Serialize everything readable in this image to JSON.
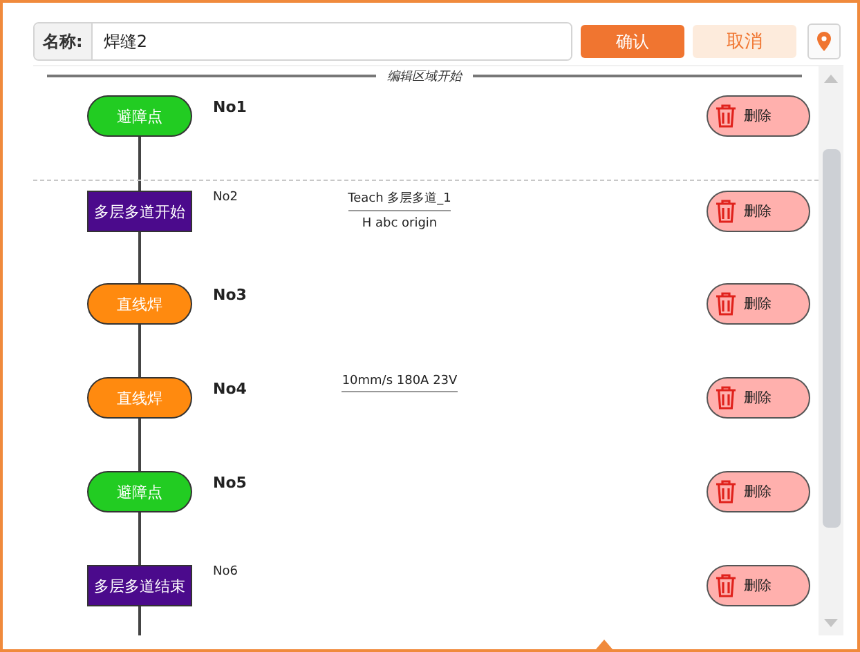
{
  "name_field": {
    "label": "名称:",
    "value": "焊缝2"
  },
  "buttons": {
    "confirm": "确认",
    "cancel": "取消"
  },
  "edit_start": "编辑区域开始",
  "steps": [
    {
      "kind": "pill",
      "color": "#22cc22",
      "node": "避障点",
      "label": "No1",
      "dashed_top": false,
      "delete": "删除"
    },
    {
      "kind": "block",
      "color": "#4b0a8c",
      "node": "多层多道开始",
      "label": "No2",
      "notes": [
        "Teach 多层多道_1",
        "H abc origin"
      ],
      "dashed_top": true,
      "delete": "删除"
    },
    {
      "kind": "pill",
      "color": "#ff8a0f",
      "node": "直线焊",
      "label": "No3",
      "dashed_top": false,
      "delete": "删除"
    },
    {
      "kind": "pill",
      "color": "#ff8a0f",
      "node": "直线焊",
      "label": "No4",
      "notes": [
        "10mm/s 180A 23V"
      ],
      "dashed_top": false,
      "delete": "删除"
    },
    {
      "kind": "pill",
      "color": "#22cc22",
      "node": "避障点",
      "label": "No5",
      "dashed_top": false,
      "delete": "删除"
    },
    {
      "kind": "block",
      "color": "#4b0a8c",
      "node": "多层多道结束",
      "label": "No6",
      "dashed_top": false,
      "delete": "删除"
    }
  ]
}
